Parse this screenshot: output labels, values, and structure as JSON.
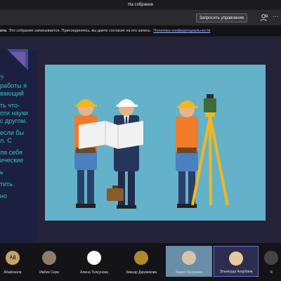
{
  "window": {
    "title": "На собрании"
  },
  "toolbar": {
    "share_label": "Запросить управление"
  },
  "notice": {
    "bold": "ата.",
    "text": "Это собрание записывается. Присоединяясь, вы даете согласие на его запись.",
    "link": "Политика конфиденциальности"
  },
  "slide_left_text": {
    "l1": "?",
    "l2": "работы я",
    "l3": "вающий",
    "l4": "ть что-",
    "l5": "оти науки",
    "l6": "с другом.",
    "l7": "если бы",
    "l8": "л. С",
    "l9": "ля себя",
    "l10": "ические",
    "l11": "ь",
    "l12": "тить",
    "l13": "но"
  },
  "participants": [
    {
      "name": "Абайханов",
      "initials": "АД"
    },
    {
      "name": "Имбек Сери",
      "initials": ""
    },
    {
      "name": "Алина Толкунова",
      "initials": ""
    },
    {
      "name": "Зимазр Джумикова",
      "initials": ""
    },
    {
      "name": "Камил Бузуанва",
      "initials": ""
    },
    {
      "name": "Эльмерда Акарбаев",
      "initials": ""
    },
    {
      "name": "Ч",
      "initials": ""
    }
  ],
  "colors": {
    "slide_background": "#63b2c9",
    "accent_text": "#2ec4c2",
    "helmet_yellow": "#f4b71b",
    "vest_orange": "#f07b2b"
  }
}
